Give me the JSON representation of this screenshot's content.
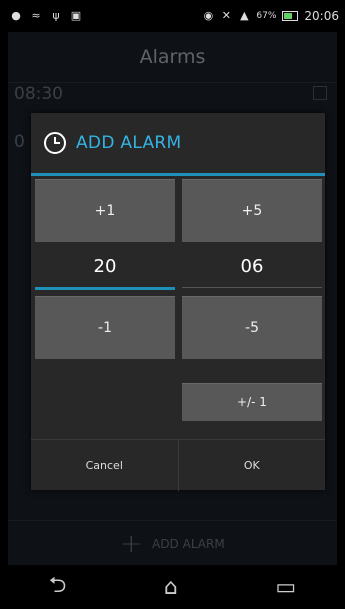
{
  "status_bar": {
    "battery_percent": "67%",
    "time": "20:06",
    "left_icons": [
      "notification-icon",
      "signal-wave-icon",
      "usb-icon",
      "image-icon"
    ],
    "right_icons": [
      "eye-icon",
      "mute-icon",
      "signal-icon",
      "battery-icon"
    ]
  },
  "app": {
    "title": "Alarms",
    "alarm1_time": "08:30",
    "alarm2_time": "0",
    "bottom_add_label": "ADD ALARM"
  },
  "dialog": {
    "title": "ADD ALARM",
    "hour_plus": "+1",
    "minute_plus": "+5",
    "hour_value": "20",
    "minute_value": "06",
    "hour_minus": "-1",
    "minute_minus": "-5",
    "toggle_minute_step": "+/- 1",
    "cancel_label": "Cancel",
    "ok_label": "OK",
    "accent_color": "#35b3e3"
  },
  "nav": {
    "back_icon": "back-icon",
    "home_icon": "home-icon",
    "recents_icon": "recents-icon"
  }
}
